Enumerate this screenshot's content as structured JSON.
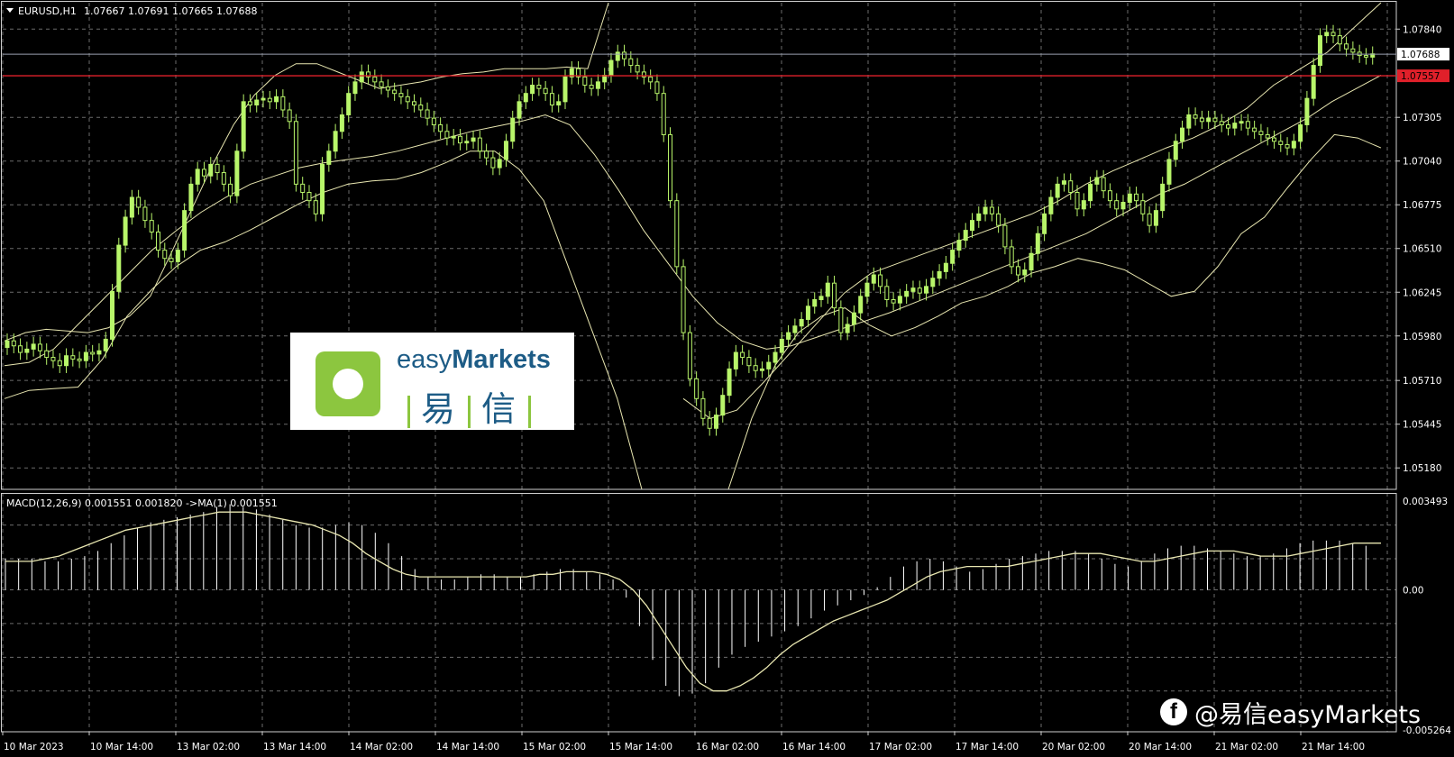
{
  "chart": {
    "symbol": "EURUSD,H1",
    "ohlc": "1.07667 1.07691 1.07665 1.07688",
    "indicator_label": "MACD(12,26,9) 0.001551 0.001820  ->MA(1) 0.001551",
    "current_price_label": "1.07688",
    "alert_price_label": "1.07557",
    "price_axis_labels": [
      "1.07840",
      "1.07305",
      "1.07040",
      "1.06775",
      "1.06510",
      "1.06245",
      "1.05980",
      "1.05710",
      "1.05445",
      "1.05180"
    ],
    "macd_axis_labels": [
      "0.003493",
      "0.00",
      "-0.005264"
    ],
    "time_axis_labels": [
      "10 Mar 2023",
      "10 Mar 14:00",
      "13 Mar 02:00",
      "13 Mar 14:00",
      "14 Mar 02:00",
      "14 Mar 14:00",
      "15 Mar 02:00",
      "15 Mar 14:00",
      "16 Mar 02:00",
      "16 Mar 14:00",
      "17 Mar 02:00",
      "17 Mar 14:00",
      "20 Mar 02:00",
      "20 Mar 14:00",
      "21 Mar 02:00",
      "21 Mar 14:00"
    ]
  },
  "colors": {
    "background": "#000000",
    "grid": "#6b6b6b",
    "candle": "#b8f56a",
    "band": "#e8e6b0",
    "alert_line": "#e0202a",
    "price_line": "#9aa0b0",
    "logo_green": "#8cc63f",
    "logo_blue": "#1d5c86"
  },
  "logo": {
    "text_light": "easy",
    "text_bold": "Markets",
    "text_cn_1": "易",
    "text_cn_2": "信"
  },
  "watermark": {
    "icon": "facebook-icon",
    "text": "@易信easyMarkets"
  },
  "chart_data": {
    "type": "candlestick",
    "symbol": "EURUSD",
    "timeframe": "H1",
    "ylim": [
      1.0505,
      1.08
    ],
    "close": [
      1.0595,
      1.0592,
      1.0588,
      1.059,
      1.0593,
      1.0589,
      1.0585,
      1.0583,
      1.058,
      1.0586,
      1.0584,
      1.0583,
      1.0588,
      1.0587,
      1.0589,
      1.0596,
      1.0625,
      1.0653,
      1.067,
      1.0682,
      1.0676,
      1.0668,
      1.0661,
      1.065,
      1.0645,
      1.0643,
      1.065,
      1.0674,
      1.069,
      1.0699,
      1.0695,
      1.0702,
      1.0697,
      1.069,
      1.0683,
      1.071,
      1.074,
      1.0738,
      1.0741,
      1.0742,
      1.074,
      1.0743,
      1.0735,
      1.0728,
      1.069,
      1.0685,
      1.068,
      1.0672,
      1.0702,
      1.071,
      1.0722,
      1.0732,
      1.0745,
      1.0752,
      1.0758,
      1.0755,
      1.0752,
      1.0749,
      1.0747,
      1.0745,
      1.0743,
      1.074,
      1.0738,
      1.0735,
      1.073,
      1.0726,
      1.0722,
      1.0718,
      1.0719,
      1.0715,
      1.0716,
      1.0718,
      1.071,
      1.0706,
      1.07,
      1.0705,
      1.0716,
      1.073,
      1.074,
      1.0745,
      1.075,
      1.0748,
      1.0745,
      1.0738,
      1.074,
      1.0755,
      1.076,
      1.0755,
      1.075,
      1.0748,
      1.0752,
      1.0756,
      1.0765,
      1.077,
      1.0766,
      1.0762,
      1.0758,
      1.0755,
      1.0752,
      1.0745,
      1.072,
      1.068,
      1.064,
      1.06,
      1.0572,
      1.056,
      1.0548,
      1.0542,
      1.055,
      1.0562,
      1.0578,
      1.0588,
      1.0585,
      1.058,
      1.0577,
      1.0578,
      1.0582,
      1.0588,
      1.0596,
      1.06,
      1.0604,
      1.0608,
      1.0616,
      1.062,
      1.0622,
      1.063,
      1.0615,
      1.06,
      1.0605,
      1.0612,
      1.0622,
      1.063,
      1.0635,
      1.0628,
      1.062,
      1.0618,
      1.0622,
      1.0625,
      1.0627,
      1.0624,
      1.0628,
      1.0633,
      1.0637,
      1.0642,
      1.065,
      1.0656,
      1.0662,
      1.0668,
      1.0672,
      1.0676,
      1.0672,
      1.0665,
      1.0652,
      1.064,
      1.0635,
      1.0638,
      1.0648,
      1.066,
      1.0672,
      1.0682,
      1.069,
      1.0692,
      1.0685,
      1.0675,
      1.068,
      1.069,
      1.0694,
      1.0686,
      1.068,
      1.0675,
      1.0679,
      1.0684,
      1.068,
      1.0672,
      1.0665,
      1.0674,
      1.069,
      1.0705,
      1.0716,
      1.0724,
      1.0732,
      1.073,
      1.0728,
      1.073,
      1.0728,
      1.0726,
      1.0724,
      1.0727,
      1.0728,
      1.0724,
      1.0722,
      1.072,
      1.0718,
      1.0716,
      1.0714,
      1.0712,
      1.0716,
      1.0726,
      1.0742,
      1.0762,
      1.078,
      1.0782,
      1.078,
      1.0775,
      1.0772,
      1.077,
      1.0768,
      1.0767,
      1.0769
    ],
    "bb_upper_segments": [
      [
        1.0595,
        1.06,
        1.0602,
        1.0601,
        1.06,
        1.0603,
        1.061,
        1.0622,
        1.0648,
        1.0675,
        1.0702,
        1.0726,
        1.0744,
        1.0756,
        1.0763,
        1.0763,
        1.0758,
        1.0753,
        1.0748,
        1.075,
        1.0752,
        1.0755,
        1.0757,
        1.0758,
        1.076,
        1.076,
        1.076,
        1.0761,
        1.076,
        1.08
      ],
      [
        1.056,
        1.0548,
        1.0553,
        1.057,
        1.0588,
        1.0606,
        1.0624,
        1.0636,
        1.0642,
        1.0648,
        1.0654,
        1.066,
        1.0666,
        1.0672,
        1.068,
        1.069,
        1.0698,
        1.0705,
        1.0712,
        1.0718,
        1.0726,
        1.0736,
        1.075,
        1.076,
        1.077,
        1.0785,
        1.08
      ]
    ],
    "bb_middle": [
      1.058,
      1.0582,
      1.059,
      1.0605,
      1.062,
      1.0635,
      1.065,
      1.0662,
      1.0673,
      1.0682,
      1.069,
      1.0695,
      1.07,
      1.0703,
      1.0705,
      1.0707,
      1.071,
      1.0714,
      1.0718,
      1.0722,
      1.0725,
      1.0728,
      1.0732,
      1.0726,
      1.0708,
      1.0686,
      1.0662,
      1.0642,
      1.0622,
      1.0606,
      1.0595,
      1.059,
      1.0592,
      1.0597,
      1.0602,
      1.0607,
      1.0612,
      1.0618,
      1.0624,
      1.063,
      1.0636,
      1.0642,
      1.0648,
      1.0654,
      1.066,
      1.0668,
      1.0676,
      1.0684,
      1.069,
      1.0698,
      1.0706,
      1.0714,
      1.0722,
      1.073,
      1.074,
      1.0748,
      1.0756
    ],
    "bb_lower_segments": [
      [
        1.056,
        1.0565,
        1.0566,
        1.0567,
        1.0584,
        1.061,
        1.0626,
        1.064,
        1.065,
        1.0655,
        1.0662,
        1.067,
        1.0678,
        1.0685,
        1.069,
        1.0692,
        1.0693,
        1.0697,
        1.0703,
        1.071,
        1.071,
        1.0699,
        1.068,
        1.064,
        1.06,
        1.056,
        1.0505
      ],
      [
        1.0505,
        1.0548,
        1.058,
        1.06,
        1.061,
        1.0615,
        1.0605,
        1.0598,
        1.0603,
        1.061,
        1.0618,
        1.0622,
        1.0628,
        1.0636,
        1.064,
        1.0645,
        1.0642,
        1.0638,
        1.063,
        1.0622,
        1.0625,
        1.064,
        1.066,
        1.067,
        1.0688,
        1.0705,
        1.072,
        1.0718,
        1.0712
      ]
    ],
    "macd_histogram": [
      0.0012,
      0.0012,
      0.0012,
      0.0011,
      0.0011,
      0.0012,
      0.0013,
      0.0015,
      0.0018,
      0.0021,
      0.0024,
      0.0026,
      0.0027,
      0.0028,
      0.0029,
      0.003,
      0.0032,
      0.0033,
      0.0032,
      0.0031,
      0.0029,
      0.0027,
      0.0025,
      0.0024,
      0.0024,
      0.0025,
      0.0026,
      0.0025,
      0.0022,
      0.0018,
      0.0013,
      0.0008,
      0.0005,
      0.0004,
      0.0004,
      0.0005,
      0.0006,
      0.0006,
      0.0005,
      0.0005,
      0.0006,
      0.0007,
      0.0008,
      0.0008,
      0.0007,
      0.0006,
      0.0004,
      -0.0003,
      -0.0014,
      -0.0027,
      -0.0037,
      -0.0041,
      -0.004,
      -0.0036,
      -0.003,
      -0.0025,
      -0.0022,
      -0.002,
      -0.0018,
      -0.0016,
      -0.0014,
      -0.0011,
      -0.0008,
      -0.0006,
      -0.0004,
      -0.0002,
      0.0001,
      0.0005,
      0.0009,
      0.0011,
      0.0012,
      0.0011,
      0.0009,
      0.0007,
      0.0008,
      0.001,
      0.0012,
      0.0013,
      0.0014,
      0.0015,
      0.0015,
      0.0015,
      0.0014,
      0.0012,
      0.001,
      0.0009,
      0.0011,
      0.0014,
      0.0016,
      0.0017,
      0.0017,
      0.0016,
      0.0015,
      0.0014,
      0.0013,
      0.0013,
      0.0014,
      0.0016,
      0.0018,
      0.0019,
      0.0019,
      0.0019,
      0.0018,
      0.0017
    ],
    "macd_signal": [
      0.0011,
      0.0011,
      0.0011,
      0.0012,
      0.0013,
      0.0015,
      0.0017,
      0.0019,
      0.0021,
      0.0023,
      0.0024,
      0.0025,
      0.0026,
      0.0027,
      0.0028,
      0.0029,
      0.003,
      0.003,
      0.003,
      0.0029,
      0.0028,
      0.0027,
      0.0026,
      0.0025,
      0.0023,
      0.0021,
      0.0018,
      0.0014,
      0.0011,
      0.0008,
      0.0006,
      0.0005,
      0.0005,
      0.0005,
      0.0005,
      0.0005,
      0.0005,
      0.0005,
      0.0005,
      0.0005,
      0.0006,
      0.0006,
      0.0007,
      0.0007,
      0.0007,
      0.0006,
      0.0004,
      0.0,
      -0.0006,
      -0.0014,
      -0.0022,
      -0.003,
      -0.0036,
      -0.0039,
      -0.0039,
      -0.0037,
      -0.0034,
      -0.003,
      -0.0025,
      -0.0021,
      -0.0018,
      -0.0015,
      -0.0012,
      -0.001,
      -0.0008,
      -0.0006,
      -0.0004,
      -0.0001,
      0.0002,
      0.0005,
      0.0007,
      0.0008,
      0.0009,
      0.0009,
      0.0009,
      0.0009,
      0.001,
      0.0011,
      0.0012,
      0.0013,
      0.0014,
      0.0014,
      0.0014,
      0.0013,
      0.0012,
      0.0011,
      0.0011,
      0.0012,
      0.0013,
      0.0014,
      0.0015,
      0.0015,
      0.0015,
      0.0014,
      0.0013,
      0.0013,
      0.0013,
      0.0014,
      0.0015,
      0.0016,
      0.0017,
      0.0018,
      0.0018,
      0.0018
    ],
    "macd_ylim": [
      -0.005264,
      0.003493
    ]
  }
}
